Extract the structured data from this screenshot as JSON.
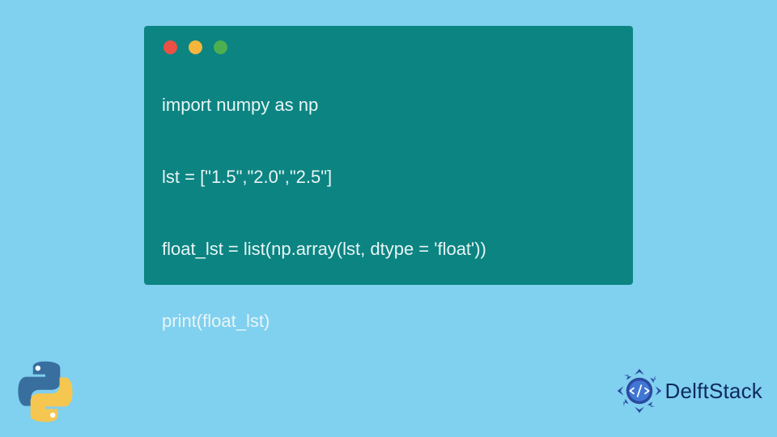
{
  "code": {
    "lines": [
      "import numpy as np",
      "",
      "lst = [\"1.5\",\"2.0\",\"2.5\"]",
      "",
      "float_lst = list(np.array(lst, dtype = 'float'))",
      "",
      "print(float_lst)"
    ]
  },
  "brand": {
    "name": "DelftStack"
  }
}
